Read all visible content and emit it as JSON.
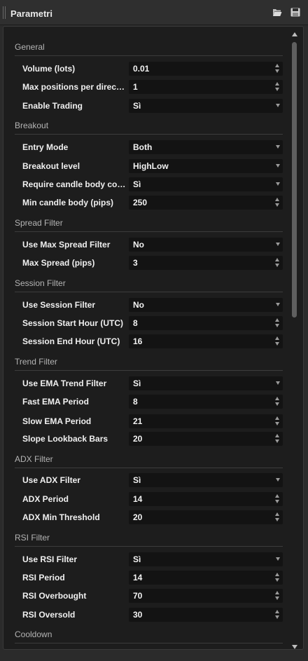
{
  "window": {
    "title": "Parametri",
    "icons": [
      "folder-open-icon",
      "save-icon"
    ]
  },
  "colors": {
    "panel_bg": "#1d1d1d",
    "control_bg": "#131313",
    "section_text": "#b4b4b4",
    "label_text": "#f0f0f0"
  },
  "sections": [
    {
      "title": "General",
      "rows": [
        {
          "label": "Volume (lots)",
          "value": "0.01",
          "control": "spinner"
        },
        {
          "label": "Max positions per direction",
          "value": "1",
          "control": "spinner"
        },
        {
          "label": "Enable Trading",
          "value": "Sì",
          "control": "dropdown"
        }
      ]
    },
    {
      "title": "Breakout",
      "rows": [
        {
          "label": "Entry Mode",
          "value": "Both",
          "control": "dropdown"
        },
        {
          "label": "Breakout level",
          "value": "HighLow",
          "control": "dropdown"
        },
        {
          "label": "Require candle body con…",
          "value": "Sì",
          "control": "dropdown"
        },
        {
          "label": "Min candle body (pips)",
          "value": "250",
          "control": "spinner"
        }
      ]
    },
    {
      "title": "Spread Filter",
      "rows": [
        {
          "label": "Use Max Spread Filter",
          "value": "No",
          "control": "dropdown"
        },
        {
          "label": "Max Spread (pips)",
          "value": "3",
          "control": "spinner"
        }
      ]
    },
    {
      "title": "Session Filter",
      "rows": [
        {
          "label": "Use Session Filter",
          "value": "No",
          "control": "dropdown"
        },
        {
          "label": "Session Start Hour (UTC)",
          "value": "8",
          "control": "spinner"
        },
        {
          "label": "Session End Hour (UTC)",
          "value": "16",
          "control": "spinner"
        }
      ]
    },
    {
      "title": "Trend Filter",
      "rows": [
        {
          "label": "Use EMA Trend Filter",
          "value": "Sì",
          "control": "dropdown"
        },
        {
          "label": "Fast EMA Period",
          "value": "8",
          "control": "spinner"
        },
        {
          "label": "Slow EMA Period",
          "value": "21",
          "control": "spinner"
        },
        {
          "label": "Slope Lookback Bars",
          "value": "20",
          "control": "spinner"
        }
      ]
    },
    {
      "title": "ADX Filter",
      "rows": [
        {
          "label": "Use ADX Filter",
          "value": "Sì",
          "control": "dropdown"
        },
        {
          "label": "ADX Period",
          "value": "14",
          "control": "spinner"
        },
        {
          "label": "ADX Min Threshold",
          "value": "20",
          "control": "spinner"
        }
      ]
    },
    {
      "title": "RSI Filter",
      "rows": [
        {
          "label": "Use RSI Filter",
          "value": "Sì",
          "control": "dropdown"
        },
        {
          "label": "RSI Period",
          "value": "14",
          "control": "spinner"
        },
        {
          "label": "RSI Overbought",
          "value": "70",
          "control": "spinner"
        },
        {
          "label": "RSI Oversold",
          "value": "30",
          "control": "spinner"
        }
      ]
    },
    {
      "title": "Cooldown",
      "rows": []
    }
  ]
}
